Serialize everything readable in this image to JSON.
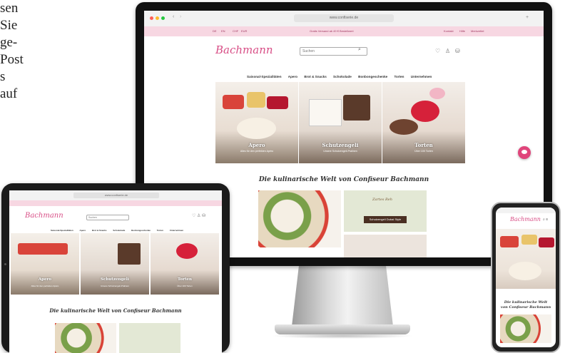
{
  "left_text": [
    "sen",
    "Sie",
    "ge-",
    "Post",
    "s",
    "auf"
  ],
  "browser": {
    "url": "www.confiserie.de",
    "promo_left": [
      "DE",
      "EN",
      "CHF",
      "EUR"
    ],
    "promo_center": "Gratis Versand ab 49 € Bestellwert",
    "promo_right": [
      "Kontakt",
      "Hilfe",
      "Merkzettel"
    ]
  },
  "site": {
    "logo": "Bachmann",
    "search_placeholder": "Suchen",
    "nav": [
      "Saisonal-Spezialitäten",
      "Apero",
      "Brot & Snacks",
      "Schokolade",
      "Bonbongeschenke",
      "Torten",
      "Unternehmen"
    ],
    "tiles": [
      {
        "title": "Apero",
        "subtitle": "Alles für den perfekten Apéro"
      },
      {
        "title": "Schutzengeli",
        "subtitle": "Unsere Schutzengeli-Pralinen"
      },
      {
        "title": "Torten",
        "subtitle": "Über 100 Torten"
      }
    ],
    "headline": "Die kulinarische Welt von Confiseur Bachmann",
    "tag_label": "Schutzengeli Dubai Style",
    "card_label": "Zartes Reh"
  },
  "phone": {
    "headline": "Die kulinarische Welt von Confiseur Bachmann"
  },
  "colors": {
    "brand": "#d84e86",
    "promo_bg": "#f7d7e2",
    "chat": "#e0457b"
  }
}
